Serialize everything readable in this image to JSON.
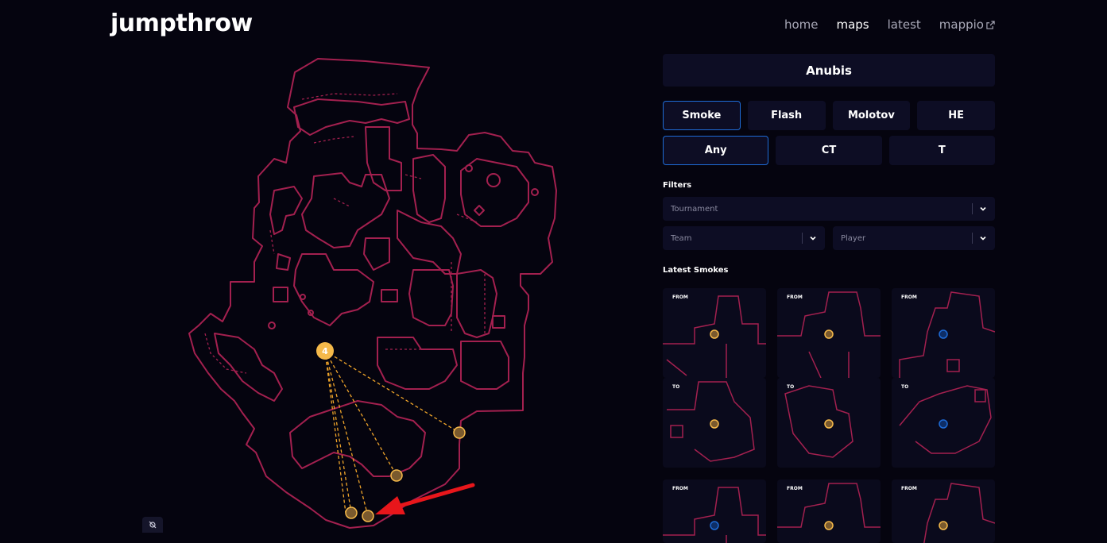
{
  "header": {
    "logo": "jumpthrow",
    "nav": [
      {
        "label": "home",
        "active": false
      },
      {
        "label": "maps",
        "active": true
      },
      {
        "label": "latest",
        "active": false
      },
      {
        "label": "mappio",
        "active": false,
        "icon": "external-link-icon"
      }
    ]
  },
  "panel": {
    "map_name": "Anubis",
    "grenade_types": [
      {
        "label": "Smoke",
        "selected": true
      },
      {
        "label": "Flash",
        "selected": false
      },
      {
        "label": "Molotov",
        "selected": false
      },
      {
        "label": "HE",
        "selected": false
      }
    ],
    "sides": [
      {
        "label": "Any",
        "selected": true
      },
      {
        "label": "CT",
        "selected": false
      },
      {
        "label": "T",
        "selected": false
      }
    ],
    "filters_label": "Filters",
    "filters": {
      "tournament_placeholder": "Tournament",
      "team_placeholder": "Team",
      "player_placeholder": "Player"
    },
    "latest_label": "Latest Smokes",
    "thumbnails": [
      {
        "tag": "FROM",
        "marker": "orange"
      },
      {
        "tag": "FROM",
        "marker": "orange"
      },
      {
        "tag": "FROM",
        "marker": "blue"
      },
      {
        "tag": "TO",
        "marker": "orange"
      },
      {
        "tag": "TO",
        "marker": "orange"
      },
      {
        "tag": "TO",
        "marker": "blue"
      },
      {
        "tag": "FROM",
        "marker": "blue"
      },
      {
        "tag": "FROM",
        "marker": "orange"
      },
      {
        "tag": "FROM",
        "marker": "orange"
      }
    ]
  },
  "map": {
    "cluster_count": "4",
    "colors": {
      "outline": "#a3204f",
      "marker": "#f5b94a",
      "line": "#f0a52a",
      "arrow": "#e8161b",
      "blue_marker": "#1e6bd6"
    }
  }
}
